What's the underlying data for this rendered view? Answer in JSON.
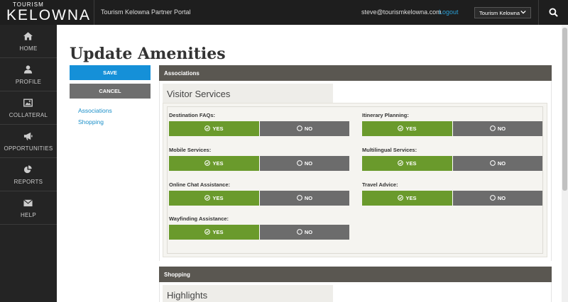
{
  "topbar": {
    "logo_small": "TOURISM",
    "logo_big": "KELOWNA",
    "portal_title": "Tourism Kelowna Partner Portal",
    "email": "steve@tourismkelowna.com",
    "logout": "Logout",
    "org_selected": "Tourism Kelowna"
  },
  "sidebar": {
    "items": [
      {
        "label": "HOME",
        "icon": "home-icon"
      },
      {
        "label": "PROFILE",
        "icon": "user-icon"
      },
      {
        "label": "COLLATERAL",
        "icon": "image-icon"
      },
      {
        "label": "OPPORTUNITIES",
        "icon": "megaphone-icon"
      },
      {
        "label": "REPORTS",
        "icon": "pie-chart-icon"
      },
      {
        "label": "HELP",
        "icon": "envelope-icon"
      }
    ]
  },
  "page": {
    "title": "Update Amenities",
    "save": "SAVE",
    "cancel": "CANCEL",
    "anchors": [
      "Associations",
      "Shopping"
    ]
  },
  "sections": [
    {
      "heading": "Associations",
      "card_title": "Visitor Services",
      "amenities": [
        {
          "label": "Destination FAQs:",
          "selected": "YES"
        },
        {
          "label": "Itinerary Planning:",
          "selected": "YES"
        },
        {
          "label": "Mobile Services:",
          "selected": "YES"
        },
        {
          "label": "Multilingual Services:",
          "selected": "YES"
        },
        {
          "label": "Online Chat Assistance:",
          "selected": "YES"
        },
        {
          "label": "Travel Advice:",
          "selected": "YES"
        },
        {
          "label": "Wayfinding Assistance:",
          "selected": "YES"
        }
      ]
    },
    {
      "heading": "Shopping",
      "card_title": "Highlights"
    }
  ],
  "labels": {
    "yes": "YES",
    "no": "NO"
  },
  "colors": {
    "topbar": "#1e1e1e",
    "sidebar": "#242424",
    "save": "#1590d8",
    "yes_active": "#6a9a2c",
    "no": "#6c6c6c",
    "section_head": "#5a5751",
    "link": "#1a8fc9"
  }
}
